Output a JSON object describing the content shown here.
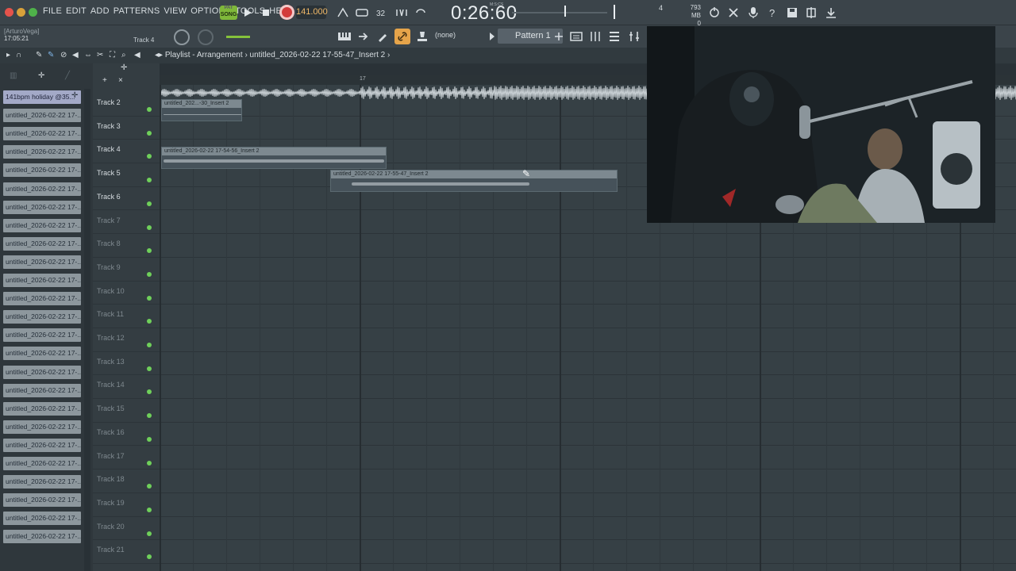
{
  "menu": [
    "FILE",
    "EDIT",
    "ADD",
    "PATTERNS",
    "VIEW",
    "OPTIONS",
    "TOOLS",
    "HELP"
  ],
  "transport": {
    "mode_top": "PAT",
    "mode_label": "SONG",
    "tempo": "141.000",
    "time": "0:26:60",
    "time_sub": "M:S:CS",
    "monitor_value": "4",
    "memory": "793 MB",
    "memory_sub": "0"
  },
  "toolbar2": {
    "user": "[ArturoVega]",
    "clock": "17:05:21",
    "track_label": "Track 4",
    "snap": "(none)",
    "pattern": "Pattern 1"
  },
  "playlist": {
    "title": "Playlist - Arrangement",
    "arrangement": "untitled_2026-02-22 17-55-47_Insert 2",
    "timeline_marker": "17"
  },
  "browser": {
    "items": [
      "141bpm holiday @35...",
      "untitled_2026-02-22 17-...",
      "untitled_2026-02-22 17-...",
      "untitled_2026-02-22 17-...",
      "untitled_2026-02-22 17-...",
      "untitled_2026-02-22 17-...",
      "untitled_2026-02-22 17-...",
      "untitled_2026-02-22 17-...",
      "untitled_2026-02-22 17-...",
      "untitled_2026-02-22 17-...",
      "untitled_2026-02-22 17-...",
      "untitled_2026-02-22 17-...",
      "untitled_2026-02-22 17-...",
      "untitled_2026-02-22 17-...",
      "untitled_2026-02-22 17-...",
      "untitled_2026-02-22 17-...",
      "untitled_2026-02-22 17-...",
      "untitled_2026-02-22 17-...",
      "untitled_2026-02-22 17-...",
      "untitled_2026-02-22 17-...",
      "untitled_2026-02-22 17-...",
      "untitled_2026-02-22 17-...",
      "untitled_2026-02-22 17-...",
      "untitled_2026-02-22 17-...",
      "untitled_2026-02-22 17-..."
    ]
  },
  "tracks": [
    "Track 2",
    "Track 3",
    "Track 4",
    "Track 5",
    "Track 6",
    "Track 7",
    "Track 8",
    "Track 9",
    "Track 10",
    "Track 11",
    "Track 12",
    "Track 13",
    "Track 14",
    "Track 15",
    "Track 16",
    "Track 17",
    "Track 18",
    "Track 19",
    "Track 20",
    "Track 21"
  ],
  "clips": {
    "clip1": "untitled_202...-30_Insert 2",
    "clip2": "untitled_2026-02-22 17-54-56_Insert 2",
    "clip3": "untitled_2026-02-22 17-55-47_Insert 2"
  },
  "colors": {
    "accent_orange": "#e6a44a",
    "record_red": "#d33b3b",
    "song_green": "#7fb83a",
    "led_green": "#6fd05a"
  }
}
